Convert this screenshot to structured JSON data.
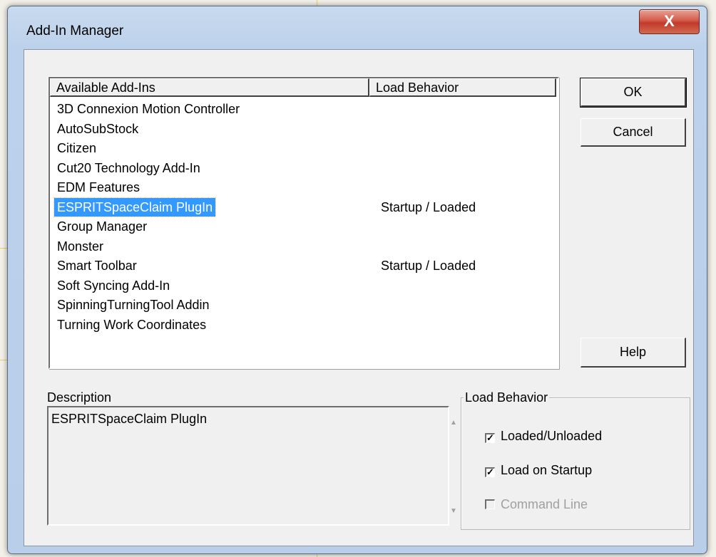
{
  "dialog": {
    "title": "Add-In Manager",
    "close_glyph": "X"
  },
  "listview": {
    "columns": [
      "Available Add-Ins",
      "Load Behavior"
    ],
    "rows": [
      {
        "name": "3D Connexion Motion Controller",
        "load": ""
      },
      {
        "name": "AutoSubStock",
        "load": ""
      },
      {
        "name": "Citizen",
        "load": ""
      },
      {
        "name": "Cut20 Technology Add-In",
        "load": ""
      },
      {
        "name": "EDM Features",
        "load": ""
      },
      {
        "name": "ESPRITSpaceClaim PlugIn",
        "load": "Startup / Loaded",
        "selected": true
      },
      {
        "name": "Group Manager",
        "load": ""
      },
      {
        "name": "Monster",
        "load": ""
      },
      {
        "name": "Smart Toolbar",
        "load": "Startup / Loaded"
      },
      {
        "name": "Soft Syncing Add-In",
        "load": ""
      },
      {
        "name": "SpinningTurningTool Addin",
        "load": ""
      },
      {
        "name": "Turning Work Coordinates",
        "load": ""
      }
    ]
  },
  "buttons": {
    "ok": "OK",
    "cancel": "Cancel",
    "help": "Help"
  },
  "description": {
    "label": "Description",
    "text": "ESPRITSpaceClaim PlugIn"
  },
  "load_behavior": {
    "label": "Load Behavior",
    "options": [
      {
        "label": "Loaded/Unloaded",
        "checked": true,
        "enabled": true
      },
      {
        "label": "Load on Startup",
        "checked": true,
        "enabled": true
      },
      {
        "label": "Command Line",
        "checked": false,
        "enabled": false
      }
    ]
  }
}
